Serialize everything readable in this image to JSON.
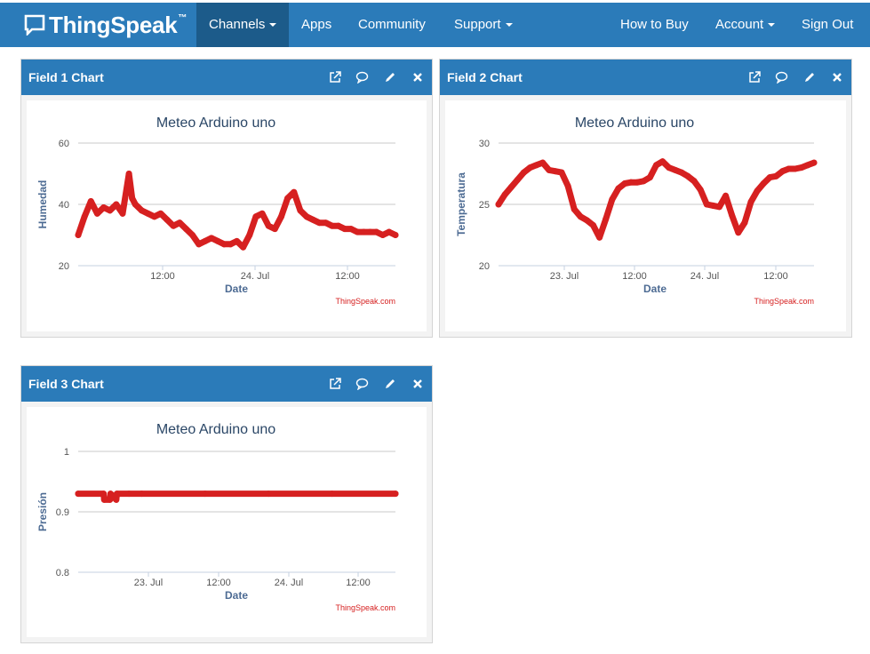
{
  "nav": {
    "brand": "ThingSpeak",
    "brand_tm": "™",
    "items": [
      "Channels",
      "Apps",
      "Community",
      "Support",
      "How to Buy",
      "Account",
      "Sign Out"
    ],
    "active": "Channels"
  },
  "panels": [
    {
      "title": "Field 1 Chart"
    },
    {
      "title": "Field 2 Chart"
    },
    {
      "title": "Field 3 Chart"
    }
  ],
  "chart_data": [
    {
      "type": "line",
      "title": "Meteo Arduino uno",
      "xlabel": "Date",
      "ylabel": "Humedad",
      "credit": "ThingSpeak.com",
      "yticks": [
        "60",
        "40",
        "20"
      ],
      "ylim": [
        20,
        60
      ],
      "xticks": [
        "12:00",
        "24. Jul",
        "12:00"
      ],
      "grid": true,
      "color": "#d62020",
      "series": [
        {
          "x": [
            0,
            0.02,
            0.04,
            0.06,
            0.08,
            0.1,
            0.12,
            0.14,
            0.16,
            0.17,
            0.18,
            0.2,
            0.22,
            0.24,
            0.26,
            0.28,
            0.3,
            0.32,
            0.34,
            0.36,
            0.38,
            0.4,
            0.42,
            0.44,
            0.46,
            0.48,
            0.5,
            0.52,
            0.54,
            0.56,
            0.58,
            0.6,
            0.62,
            0.64,
            0.66,
            0.68,
            0.7,
            0.72,
            0.74,
            0.76,
            0.78,
            0.8,
            0.82,
            0.84,
            0.86,
            0.88,
            0.9,
            0.92,
            0.94,
            0.96,
            0.98,
            1.0
          ],
          "values": [
            30,
            36,
            41,
            37,
            39,
            38,
            40,
            37,
            50,
            42,
            40,
            38,
            37,
            36,
            37,
            35,
            33,
            34,
            32,
            30,
            27,
            28,
            29,
            28,
            27,
            27,
            28,
            26,
            30,
            36,
            37,
            33,
            32,
            36,
            42,
            44,
            38,
            36,
            35,
            34,
            34,
            33,
            33,
            32,
            32,
            31,
            31,
            31,
            31,
            30,
            31,
            30
          ]
        }
      ]
    },
    {
      "type": "line",
      "title": "Meteo Arduino uno",
      "xlabel": "Date",
      "ylabel": "Temperatura",
      "credit": "ThingSpeak.com",
      "yticks": [
        "30",
        "25",
        "20"
      ],
      "ylim": [
        20,
        30
      ],
      "xticks": [
        "23. Jul",
        "12:00",
        "24. Jul",
        "12:00"
      ],
      "grid": true,
      "color": "#d62020",
      "series": [
        {
          "x": [
            0,
            0.02,
            0.04,
            0.06,
            0.08,
            0.1,
            0.12,
            0.14,
            0.16,
            0.18,
            0.2,
            0.22,
            0.24,
            0.26,
            0.28,
            0.3,
            0.32,
            0.34,
            0.36,
            0.38,
            0.4,
            0.42,
            0.44,
            0.46,
            0.48,
            0.5,
            0.52,
            0.54,
            0.56,
            0.58,
            0.6,
            0.62,
            0.64,
            0.66,
            0.68,
            0.7,
            0.72,
            0.74,
            0.76,
            0.78,
            0.8,
            0.82,
            0.84,
            0.86,
            0.88,
            0.9,
            0.92,
            0.94,
            0.96,
            0.98,
            1.0
          ],
          "values": [
            25,
            25.8,
            26.4,
            27,
            27.6,
            28,
            28.2,
            28.4,
            27.8,
            27.7,
            27.6,
            26.5,
            24.6,
            24.0,
            23.7,
            23.3,
            22.3,
            23.8,
            25.4,
            26.3,
            26.7,
            26.8,
            26.8,
            26.9,
            27.2,
            28.2,
            28.5,
            28.0,
            27.8,
            27.6,
            27.3,
            26.9,
            26.2,
            25.0,
            24.9,
            24.8,
            25.7,
            24.1,
            22.7,
            23.5,
            25.2,
            26.1,
            26.7,
            27.2,
            27.3,
            27.7,
            27.9,
            27.9,
            28.0,
            28.2,
            28.4
          ]
        }
      ]
    },
    {
      "type": "line",
      "title": "Meteo Arduino uno",
      "xlabel": "Date",
      "ylabel": "Presión",
      "credit": "ThingSpeak.com",
      "yticks": [
        "1",
        "0.9",
        "0.8"
      ],
      "ylim": [
        0.8,
        1.0
      ],
      "xticks": [
        "23. Jul",
        "12:00",
        "24. Jul",
        "12:00"
      ],
      "grid": true,
      "color": "#d62020",
      "series": [
        {
          "x": [
            0,
            0.08,
            0.082,
            0.1,
            0.102,
            0.12,
            0.122,
            0.16,
            0.2,
            0.4,
            0.6,
            0.8,
            1.0
          ],
          "values": [
            0.93,
            0.93,
            0.92,
            0.92,
            0.93,
            0.92,
            0.93,
            0.93,
            0.93,
            0.93,
            0.93,
            0.93,
            0.93
          ]
        }
      ]
    }
  ]
}
